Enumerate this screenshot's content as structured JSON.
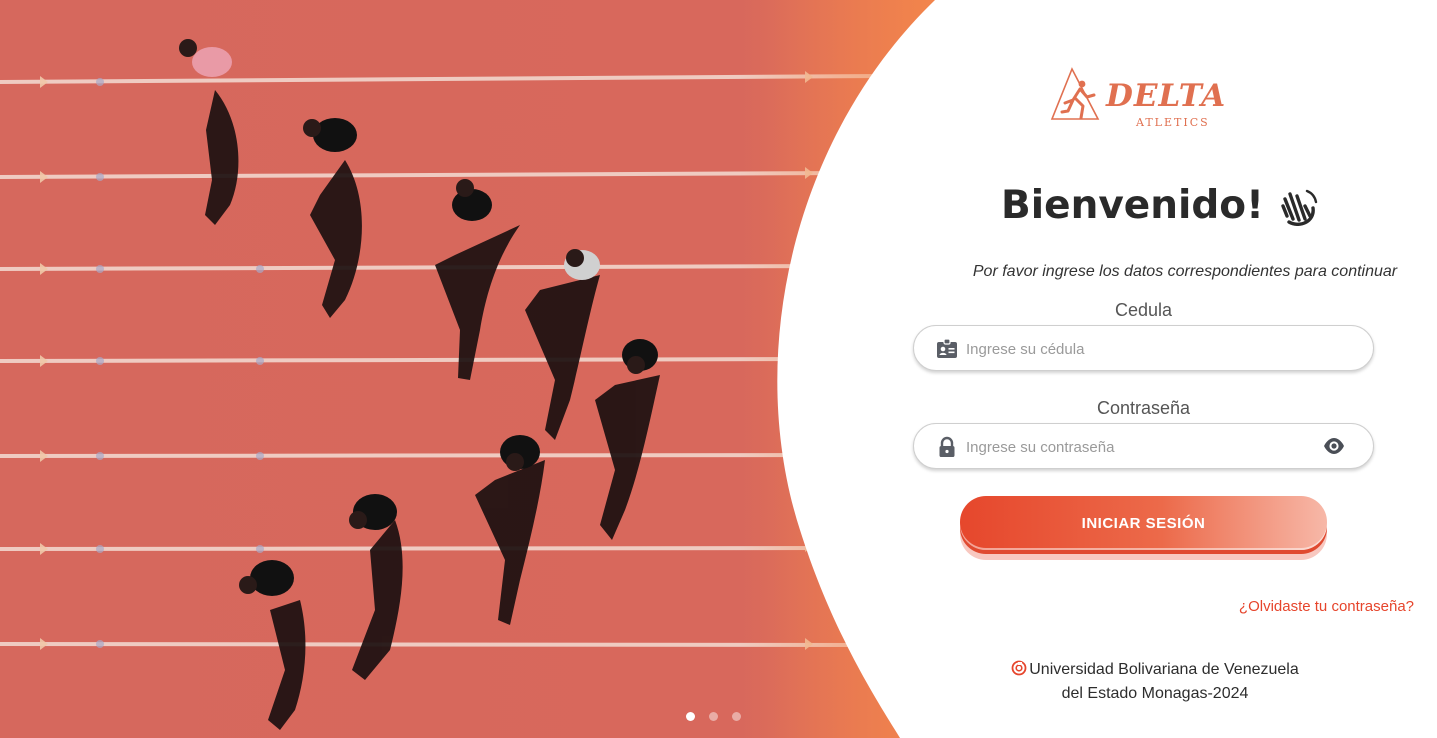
{
  "hero": {
    "image_icon": "running-track-photo",
    "carousel": {
      "count": 3,
      "active": 0
    }
  },
  "brand": {
    "name": "DELTA",
    "tagline": "ATLETICS",
    "icon": "runner-triangle-logo",
    "accent": "#e07050"
  },
  "welcome": {
    "title": "Bienvenido!",
    "icon": "waving-hand-icon",
    "subtitle": "Por favor ingrese los datos correspondientes para continuar"
  },
  "form": {
    "cedula": {
      "label": "Cedula",
      "placeholder": "Ingrese su cédula",
      "value": "",
      "icon": "id-card-icon"
    },
    "password": {
      "label": "Contraseña",
      "placeholder": "Ingrese su contraseña",
      "value": "",
      "icon": "lock-icon",
      "toggle_icon": "eye-icon"
    },
    "submit_label": "INICIAR SESIÓN",
    "forgot_label": "¿Olvidaste tu contraseña?"
  },
  "footer": {
    "line1": "Universidad Bolivariana de Venezuela",
    "line2": "del Estado Monagas-2024",
    "icon": "ubv-logo-icon"
  },
  "colors": {
    "primary": "#e6452c",
    "track": "#d7665b",
    "text": "#2a2a2a"
  }
}
